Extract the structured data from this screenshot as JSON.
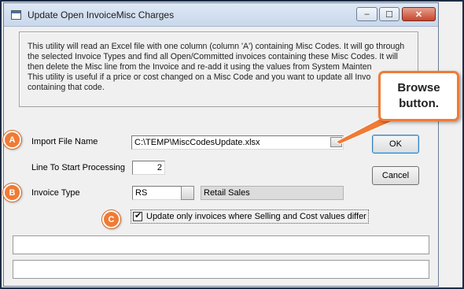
{
  "window": {
    "title": "Update Open InvoiceMisc Charges",
    "controls": {
      "minimize": "–",
      "maximize": "☐",
      "close": "✕"
    }
  },
  "description": {
    "lines": [
      "This utility will read an Excel file with one column (column 'A') containing Misc Codes.  It will go through",
      "the selected Invoice Types and find all Open/Committed invoices containing these Misc Codes.  It will",
      "then delete the Misc line from the Invoice and re-add it using the values from System Mainten",
      "This utility is useful if a price or cost changed on a Misc Code and you want to update all Invo",
      "containing that code."
    ]
  },
  "form": {
    "import_file": {
      "label": "Import File Name",
      "value": "C:\\TEMP\\MiscCodesUpdate.xlsx"
    },
    "line_start": {
      "label": "Line To Start Processing",
      "value": "2"
    },
    "invoice_type": {
      "label": "Invoice Type",
      "value": "RS",
      "description": "Retail Sales"
    },
    "update_checkbox": {
      "label": "Update only invoices where Selling and Cost values differ",
      "checked": true
    }
  },
  "buttons": {
    "ok": "OK",
    "cancel": "Cancel"
  },
  "annotations": {
    "badge_a": "A",
    "badge_b": "B",
    "badge_c": "C",
    "callout_line1": "Browse",
    "callout_line2": "button.",
    "accent_color": "#ef7b35"
  }
}
